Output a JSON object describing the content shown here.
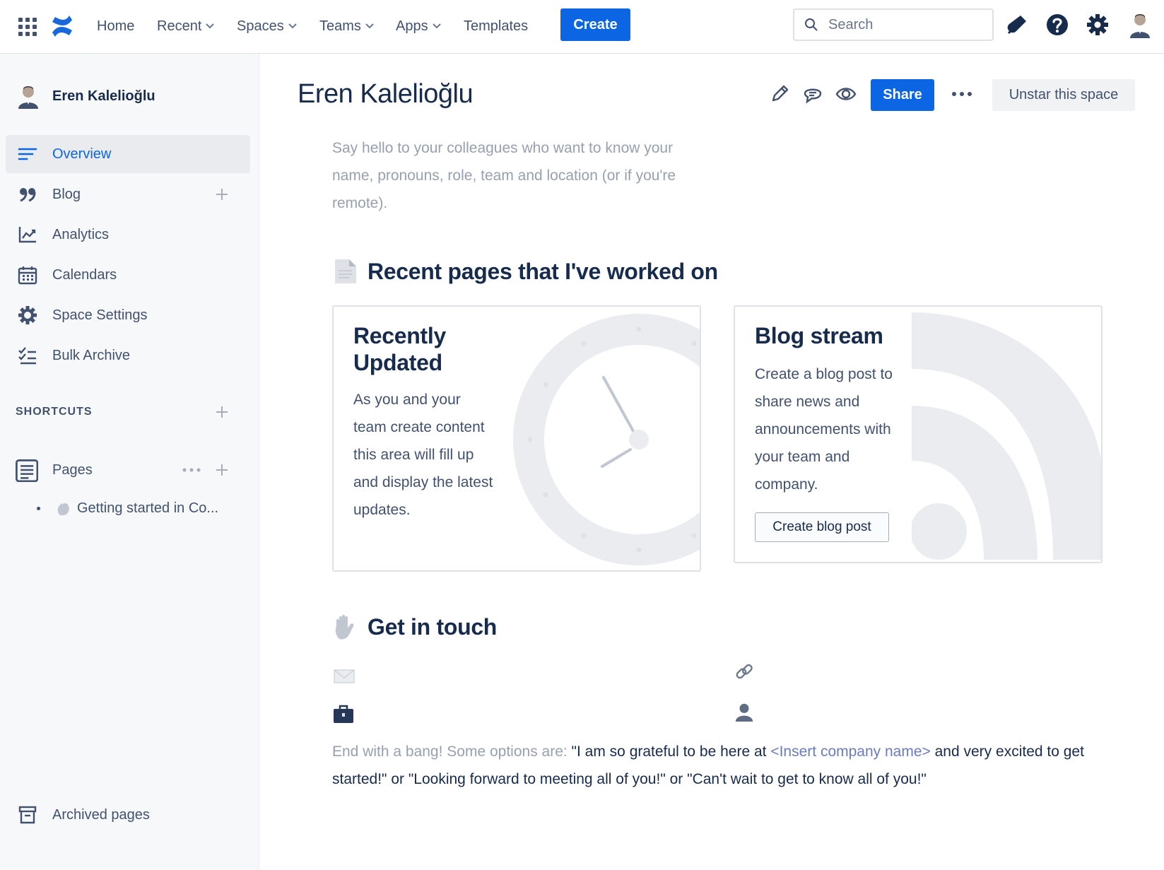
{
  "topnav": {
    "items": [
      {
        "label": "Home"
      },
      {
        "label": "Recent"
      },
      {
        "label": "Spaces"
      },
      {
        "label": "Teams"
      },
      {
        "label": "Apps"
      },
      {
        "label": "Templates"
      }
    ],
    "create_label": "Create",
    "search_placeholder": "Search",
    "icons": [
      "app-switcher-icon",
      "confluence-logo-icon",
      "notification-icon",
      "help-icon",
      "settings-icon",
      "profile-avatar"
    ]
  },
  "sidebar": {
    "space_name": "Eren Kalelioğlu",
    "items": [
      {
        "label": "Overview",
        "icon": "overview-icon"
      },
      {
        "label": "Blog",
        "icon": "quote-icon"
      },
      {
        "label": "Analytics",
        "icon": "analytics-icon"
      },
      {
        "label": "Calendars",
        "icon": "calendar-icon"
      },
      {
        "label": "Space Settings",
        "icon": "gear-icon"
      },
      {
        "label": "Bulk Archive",
        "icon": "bulk-archive-icon"
      }
    ],
    "shortcuts_label": "SHORTCUTS",
    "pages_label": "Pages",
    "child_page": "Getting started in Co...",
    "archived_label": "Archived pages"
  },
  "main": {
    "title": "Eren Kalelioğlu",
    "share_label": "Share",
    "unstar_label": "Unstar this space",
    "intro_text": "Say hello to your colleagues who want to know your name, pronouns, role, team and location (or if you're remote).",
    "recent_heading": "Recent pages that I've worked on",
    "recent_card": {
      "title": "Recently Updated",
      "text": "As you and your team create content this area will fill up and display the latest updates."
    },
    "blog_card": {
      "title": "Blog stream",
      "text": "Create a blog post to share news and announcements with your team and company.",
      "button": "Create blog post"
    },
    "contact_heading": "Get in touch",
    "outro": {
      "prefix": "End with a bang! Some options are: ",
      "quote_start": "\"I am so grateful to be here at ",
      "placeholder": "<Insert company name>",
      "quote_end": " and very excited to get started!\" or \"Looking forward to meeting all of you!\" or \"Can't wait to get to know all of you!\""
    }
  },
  "colors": {
    "primary": "#0c66e4",
    "text": "#172b4d",
    "muted": "#97a0af",
    "sidebar_bg": "#f7f8f9"
  }
}
